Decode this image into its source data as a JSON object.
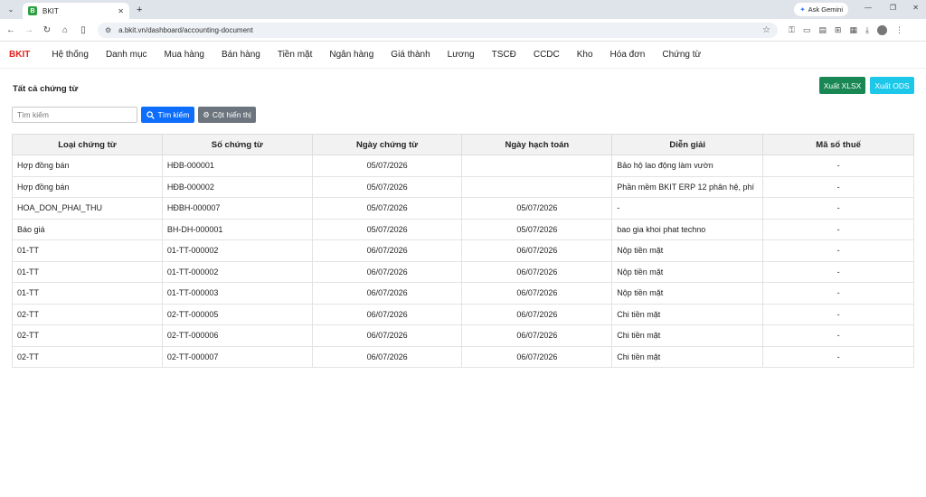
{
  "browser": {
    "tab_title": "BKIT",
    "favicon_letter": "B",
    "url": "a.bkit.vn/dashboard/accounting-document",
    "ask_gemini": "Ask Gemini"
  },
  "app": {
    "brand": "BKIT",
    "nav": [
      "Hệ thống",
      "Danh mục",
      "Mua hàng",
      "Bán hàng",
      "Tiền mặt",
      "Ngân hàng",
      "Giá thành",
      "Lương",
      "TSCĐ",
      "CCDC",
      "Kho",
      "Hóa đơn",
      "Chứng từ"
    ]
  },
  "page": {
    "title": "Tất cả chứng từ",
    "export_xlsx": "Xuất XLSX",
    "export_ods": "Xuất ODS",
    "search_placeholder": "Tìm kiếm",
    "search_button": "Tìm kiếm",
    "columns_button": "Cột hiển thị"
  },
  "table": {
    "headers": [
      "Loại chứng từ",
      "Số chứng từ",
      "Ngày chứng từ",
      "Ngày hạch toán",
      "Diễn giải",
      "Mã số thuế"
    ],
    "rows": [
      [
        "Hợp đồng bán",
        "HĐB-000001",
        "05/07/2026",
        "",
        "Bảo hộ lao động làm vườn",
        "-"
      ],
      [
        "Hợp đồng bán",
        "HĐB-000002",
        "05/07/2026",
        "",
        "Phần mềm BKIT ERP 12 phân hệ, phí",
        "-"
      ],
      [
        "HOA_DON_PHAI_THU",
        "HĐBH-000007",
        "05/07/2026",
        "05/07/2026",
        "-",
        "-"
      ],
      [
        "Báo giá",
        "BH-DH-000001",
        "05/07/2026",
        "05/07/2026",
        "bao gia khoi phat techno",
        "-"
      ],
      [
        "01-TT",
        "01-TT-000002",
        "06/07/2026",
        "06/07/2026",
        "Nộp tiền mặt",
        "-"
      ],
      [
        "01-TT",
        "01-TT-000002",
        "06/07/2026",
        "06/07/2026",
        "Nộp tiền mặt",
        "-"
      ],
      [
        "01-TT",
        "01-TT-000003",
        "06/07/2026",
        "06/07/2026",
        "Nộp tiền mặt",
        "-"
      ],
      [
        "02-TT",
        "02-TT-000005",
        "06/07/2026",
        "06/07/2026",
        "Chi tiền mặt",
        "-"
      ],
      [
        "02-TT",
        "02-TT-000006",
        "06/07/2026",
        "06/07/2026",
        "Chi tiền mặt",
        "-"
      ],
      [
        "02-TT",
        "02-TT-000007",
        "06/07/2026",
        "06/07/2026",
        "Chi tiền mặt",
        "-"
      ]
    ]
  },
  "colors": {
    "brand": "#e1251b",
    "xlsx": "#198754",
    "ods": "#1cc8ea",
    "search": "#0d6efd",
    "columns": "#6c757d"
  }
}
